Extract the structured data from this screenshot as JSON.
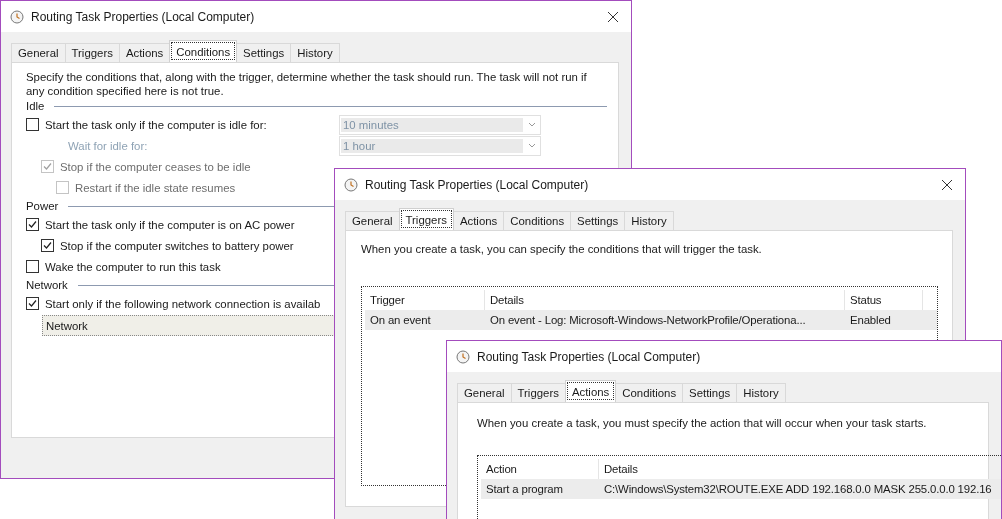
{
  "windows": [
    {
      "kind": "conditions",
      "title": "Routing Task Properties (Local Computer)",
      "tabs": [
        {
          "label": "General",
          "selected": false
        },
        {
          "label": "Triggers",
          "selected": false
        },
        {
          "label": "Actions",
          "selected": false
        },
        {
          "label": "Conditions",
          "selected": true
        },
        {
          "label": "Settings",
          "selected": false
        },
        {
          "label": "History",
          "selected": false
        }
      ],
      "description": "Specify the conditions that, along with the trigger, determine whether the task should run.  The task will not run  if any condition specified here is not true.",
      "sections": [
        {
          "heading": "Idle",
          "items": [
            {
              "kind": "checkbox",
              "label": "Start the task only if the computer is idle for:",
              "checked": false,
              "disabled": false,
              "dropdown": {
                "value": "10 minutes",
                "disabled": true
              },
              "children": [
                {
                  "kind": "label",
                  "label": "Wait for idle for:",
                  "disabled": true,
                  "dropdown": {
                    "value": "1 hour",
                    "disabled": true
                  }
                },
                {
                  "kind": "checkbox",
                  "label": "Stop if the computer ceases to be idle",
                  "checked": true,
                  "disabled": true,
                  "children": [
                    {
                      "kind": "checkbox",
                      "label": "Restart if the idle state resumes",
                      "checked": false,
                      "disabled": true
                    }
                  ]
                }
              ]
            }
          ]
        },
        {
          "heading": "Power",
          "items": [
            {
              "kind": "checkbox",
              "label": "Start the task only if the computer is on AC power",
              "checked": true,
              "disabled": false,
              "children": [
                {
                  "kind": "checkbox",
                  "label": "Stop if the computer switches to battery power",
                  "checked": true,
                  "disabled": false
                }
              ]
            },
            {
              "kind": "checkbox",
              "label": "Wake the computer to run this task",
              "checked": false,
              "disabled": false
            }
          ]
        },
        {
          "heading": "Network",
          "items": [
            {
              "kind": "checkbox",
              "label": "Start only if the following network connection is availab",
              "checked": true,
              "disabled": false,
              "children": [
                {
                  "kind": "select",
                  "value": "Network"
                }
              ]
            }
          ]
        }
      ]
    },
    {
      "kind": "triggers",
      "title": "Routing Task Properties (Local Computer)",
      "tabs": [
        {
          "label": "General",
          "selected": false
        },
        {
          "label": "Triggers",
          "selected": true
        },
        {
          "label": "Actions",
          "selected": false
        },
        {
          "label": "Conditions",
          "selected": false
        },
        {
          "label": "Settings",
          "selected": false
        },
        {
          "label": "History",
          "selected": false
        }
      ],
      "description": "When you create a task, you can specify the conditions that will trigger the task.",
      "table": {
        "columns": [
          "Trigger",
          "Details",
          "Status"
        ],
        "rows": [
          {
            "cells": [
              "On an event",
              "On event - Log: Microsoft-Windows-NetworkProfile/Operationa...",
              "Enabled"
            ],
            "selected": true
          }
        ]
      }
    },
    {
      "kind": "actions",
      "title": "Routing Task Properties (Local Computer)",
      "tabs": [
        {
          "label": "General",
          "selected": false
        },
        {
          "label": "Triggers",
          "selected": false
        },
        {
          "label": "Actions",
          "selected": true
        },
        {
          "label": "Conditions",
          "selected": false
        },
        {
          "label": "Settings",
          "selected": false
        },
        {
          "label": "History",
          "selected": false
        }
      ],
      "description": "When you create a task, you must specify the action that will occur when your task starts.",
      "table": {
        "columns": [
          "Action",
          "Details"
        ],
        "rows": [
          {
            "cells": [
              "Start a program",
              "C:\\Windows\\System32\\ROUTE.EXE ADD 192.168.0.0 MASK 255.0.0.0 192.16"
            ],
            "selected": true
          }
        ]
      }
    }
  ]
}
